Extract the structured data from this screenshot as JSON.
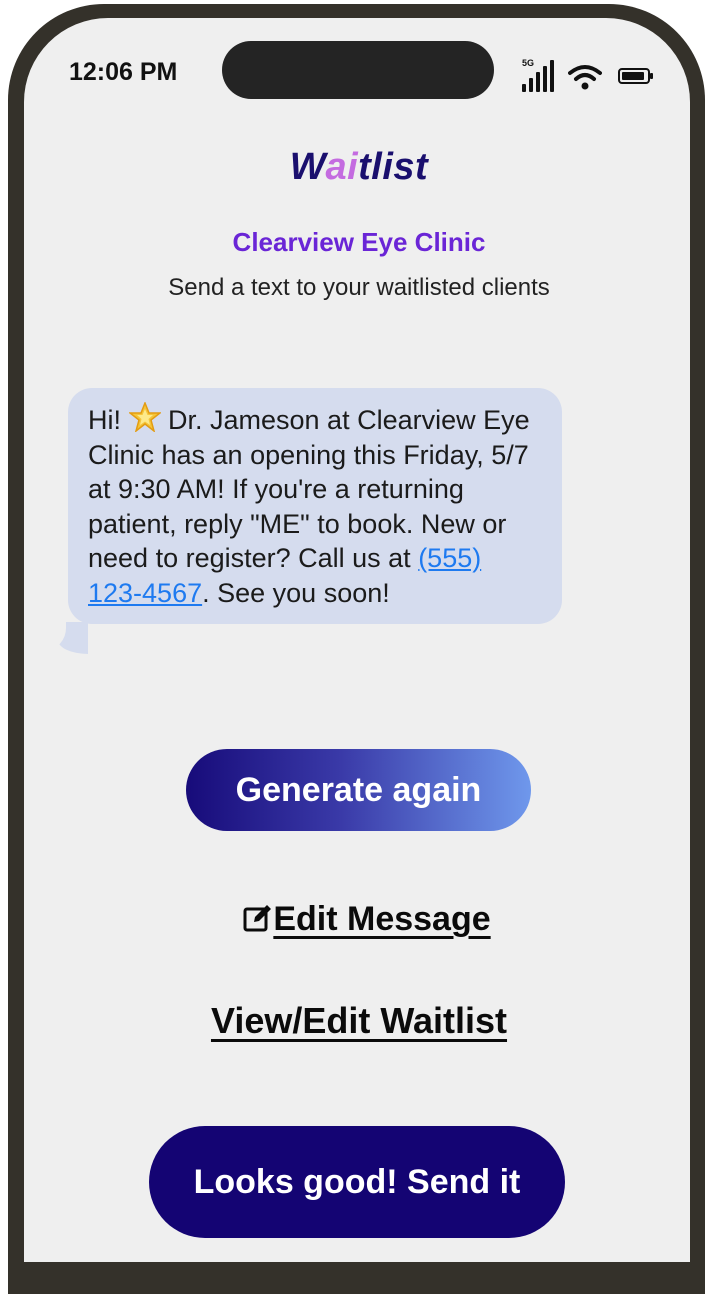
{
  "status_bar": {
    "time": "12:06 PM",
    "network": "5G",
    "icons": [
      "cellular-signal-icon",
      "wifi-icon",
      "battery-icon"
    ]
  },
  "app": {
    "title_prefix": "W",
    "title_accent": "ai",
    "title_suffix": "tlist",
    "clinic_name": "Clearview Eye Clinic",
    "subtitle": "Send a text to your waitlisted clients"
  },
  "message": {
    "text_before_emoji": "Hi! ",
    "emoji_icon": "star-icon",
    "text_after_emoji": " Dr. Jameson at Clearview Eye Clinic has an opening this Friday, 5/7 at 9:30 AM! If you're a returning patient, reply \"ME\" to book. New or need to register? Call us at ",
    "phone_link": "(555) 123-4567",
    "text_end": ". See you soon!"
  },
  "actions": {
    "generate_again": "Generate again",
    "edit_message": "Edit Message",
    "edit_icon": "edit-icon",
    "view_edit_waitlist": "View/Edit Waitlist",
    "send": "Looks good! Send it"
  },
  "colors": {
    "title": "#1a0f6e",
    "title_accent": "#c46be0",
    "clinic": "#6a25d6",
    "bubble": "#d5dcee",
    "link": "#1e7af0",
    "send_button": "#140473"
  }
}
